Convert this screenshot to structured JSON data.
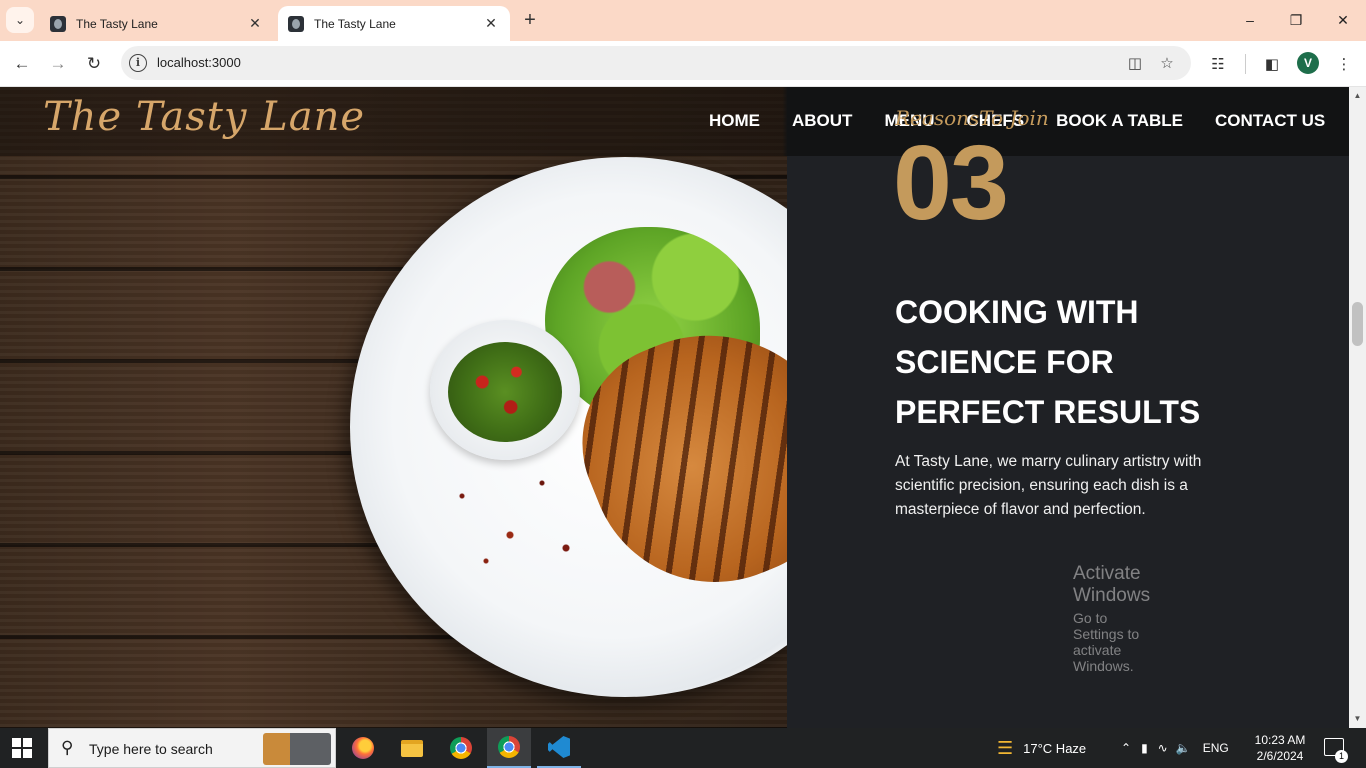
{
  "browser": {
    "tabs": [
      {
        "title": "The Tasty Lane",
        "active": false
      },
      {
        "title": "The Tasty Lane",
        "active": true
      }
    ],
    "url": "localhost:3000",
    "profile_initial": "V"
  },
  "site": {
    "logo": "The Tasty Lane",
    "nav": [
      "HOME",
      "ABOUT",
      "MENU",
      "CHEFS",
      "BOOK A TABLE",
      "CONTACT US"
    ]
  },
  "section": {
    "eyebrow": "ReasonsTo Join",
    "number": "03",
    "headline_lines": [
      "COOKING WITH",
      "SCIENCE FOR",
      "PERFECT RESULTS"
    ],
    "description_lines": [
      "At Tasty Lane, we marry culinary artistry with",
      "scientific precision, ensuring each dish is a",
      "masterpiece of flavor and perfection."
    ],
    "accent_color": "#c49a5c"
  },
  "watermark": {
    "title": "Activate Windows",
    "subtitle": "Go to Settings to activate Windows."
  },
  "taskbar": {
    "search_placeholder": "Type here to search",
    "weather": "17°C  Haze",
    "language": "ENG",
    "time": "10:23 AM",
    "date": "2/6/2024",
    "notification_count": "1"
  }
}
